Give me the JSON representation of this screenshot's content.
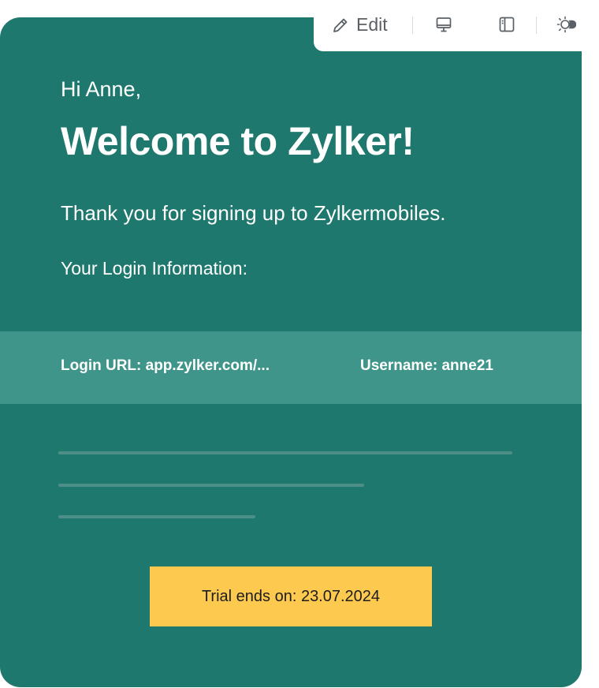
{
  "toolbar": {
    "edit_label": "Edit",
    "icons": [
      "pencil-icon",
      "desktop-icon",
      "sidebar-panel-icon",
      "theme-toggle-icon"
    ]
  },
  "email": {
    "greeting": "Hi Anne,",
    "title": "Welcome to Zylker!",
    "thanks": "Thank you for signing up to Zylkermobiles.",
    "login_heading": "Your Login Information:",
    "login_url": "Login URL: app.zylker.com/...",
    "username": "Username: anne21",
    "trial_label": "Trial ends on: 23.07.2024"
  },
  "colors": {
    "card_bg": "#1e786d",
    "band_bg": "#3f958a",
    "trial_bg": "#fdc94e",
    "placeholder_line": "#4d8f86"
  }
}
